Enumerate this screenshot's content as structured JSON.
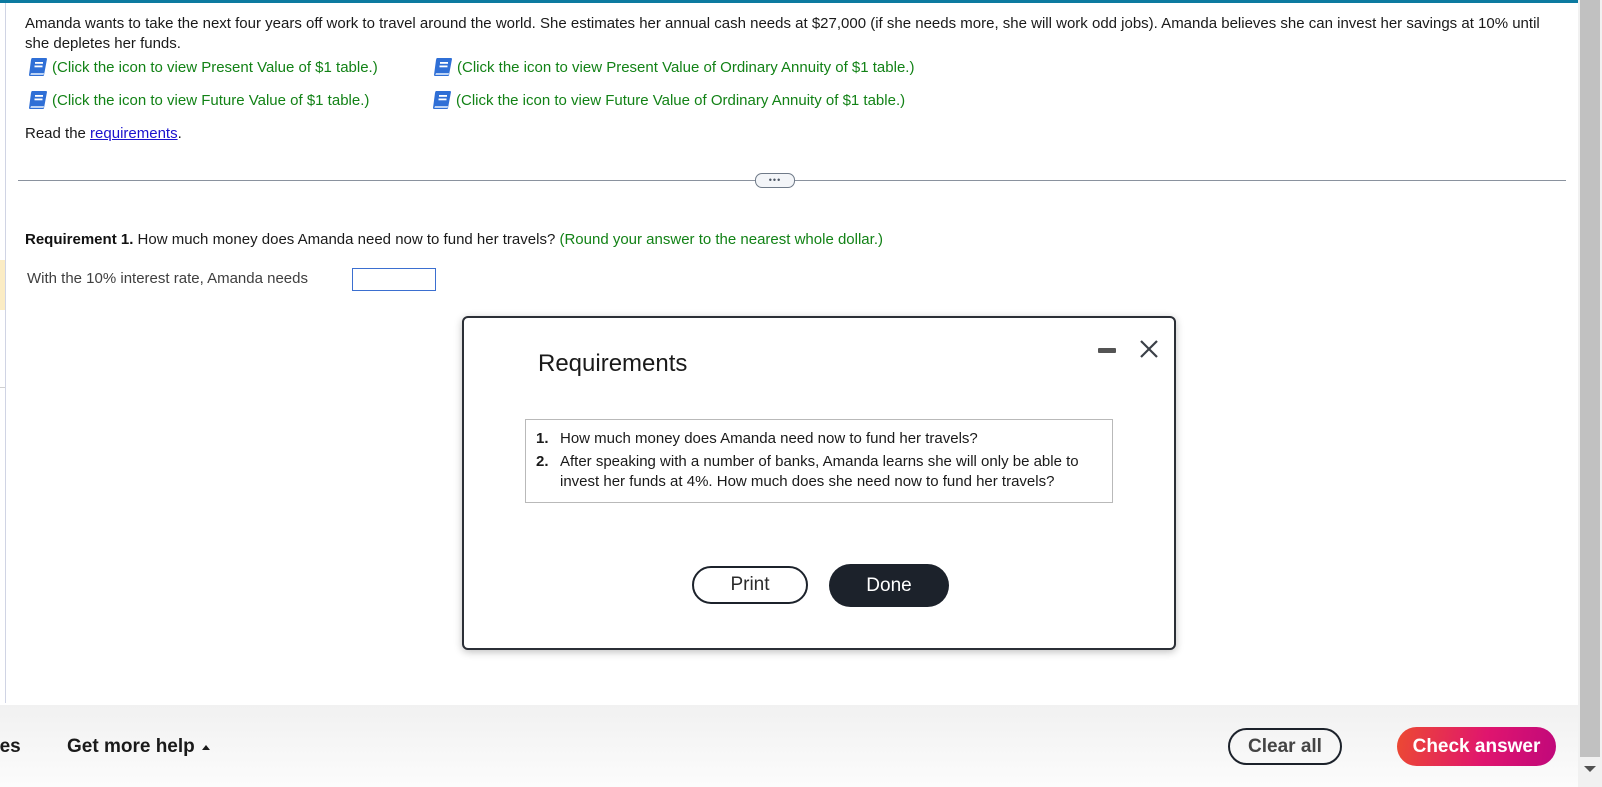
{
  "question": {
    "text": "Amanda wants to take the next four years off work to travel around the world. She estimates her annual cash needs at $27,000 (if she needs more, she will work odd jobs). Amanda believes she can invest her savings at 10% until she depletes her funds."
  },
  "table_links": [
    {
      "icon": "book-icon",
      "label": "(Click the icon to view Present Value of $1 table.)"
    },
    {
      "icon": "book-icon",
      "label": "(Click the icon to view Present Value of Ordinary Annuity of $1 table.)"
    },
    {
      "icon": "book-icon",
      "label": "(Click the icon to view Future Value of $1 table.)"
    },
    {
      "icon": "book-icon",
      "label": "(Click the icon to view Future Value of Ordinary Annuity of $1 table.)"
    }
  ],
  "read_requirements": {
    "prefix": "Read the ",
    "link": "requirements",
    "suffix": "."
  },
  "expand_label": "•••",
  "requirement1": {
    "label": "Requirement 1.",
    "question": " How much money does Amanda need now to fund her travels? ",
    "hint": "(Round your answer to the nearest whole dollar.)",
    "answer_prompt": "With the 10% interest rate, Amanda needs",
    "answer_value": ""
  },
  "modal": {
    "title": "Requirements",
    "items": [
      {
        "num": "1.",
        "text": "How much money does Amanda need now to fund her travels?"
      },
      {
        "num": "2.",
        "text": "After speaking with a number of banks, Amanda learns she will only be able to invest her funds at 4%. How much does she need now to fund her travels?"
      }
    ],
    "print_label": "Print",
    "done_label": "Done"
  },
  "footer": {
    "left_partial": "ges",
    "more_help": "Get more help",
    "clear_all": "Clear all",
    "check_answer": "Check answer"
  },
  "colors": {
    "accent_topbar": "#0c7aa0",
    "link_green": "#128216",
    "link_blue": "#1b12ce",
    "check_gradient_start": "#ec4a32",
    "check_gradient_end": "#c0087b",
    "dark_button": "#1c222b"
  }
}
